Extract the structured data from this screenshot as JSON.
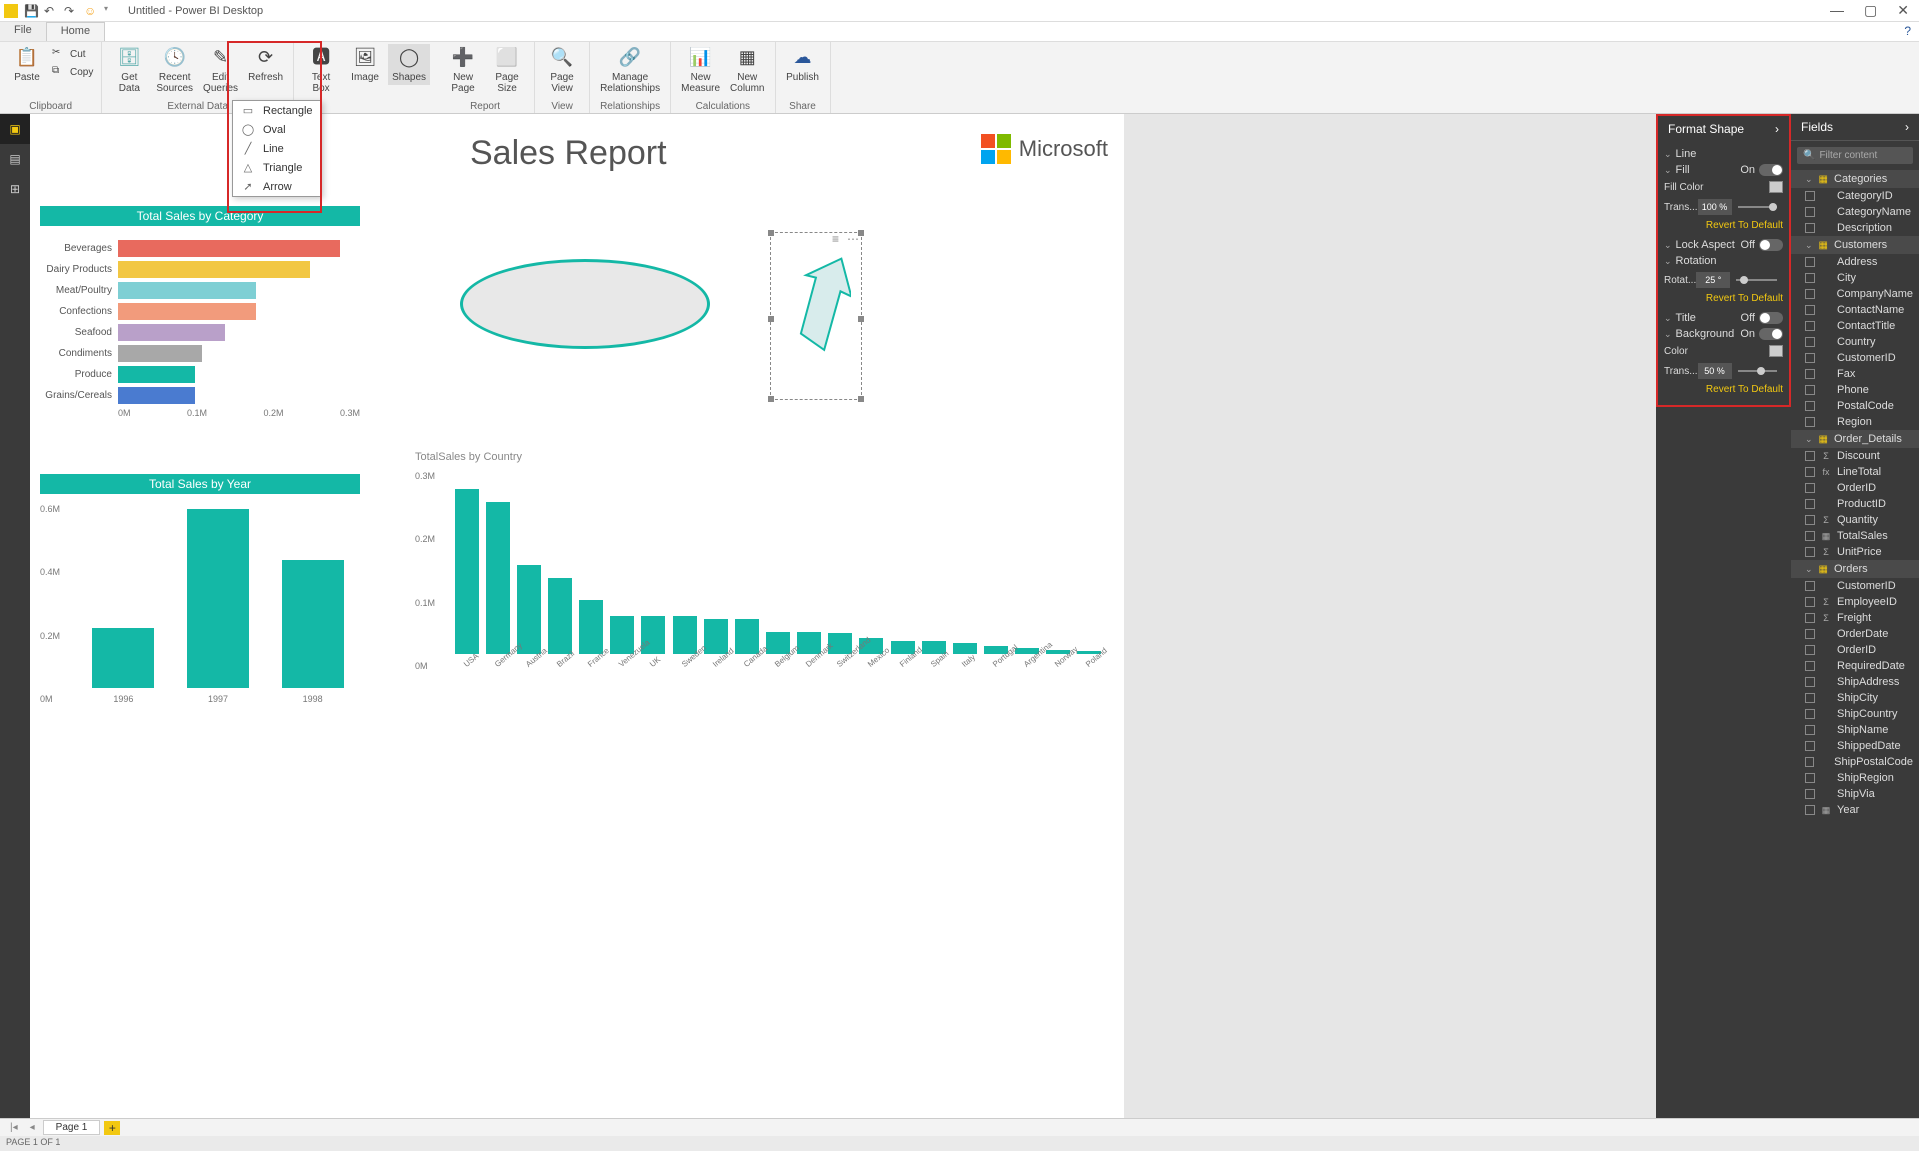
{
  "titlebar": {
    "title": "Untitled - Power BI Desktop"
  },
  "menutabs": {
    "file": "File",
    "home": "Home"
  },
  "ribbon": {
    "clipboard": {
      "label": "Clipboard",
      "paste": "Paste",
      "cut": "Cut",
      "copy": "Copy"
    },
    "external": {
      "label": "External Data",
      "getdata": "Get\nData",
      "recent": "Recent\nSources",
      "edit": "Edit\nQueries",
      "refresh": "Refresh"
    },
    "insert": {
      "textbox": "Text\nBox",
      "image": "Image",
      "shapes": "Shapes"
    },
    "report": {
      "label": "Report",
      "newpage": "New\nPage",
      "pagesize": "Page\nSize"
    },
    "view": {
      "label": "View",
      "pageview": "Page\nView"
    },
    "rel": {
      "label": "Relationships",
      "manage": "Manage\nRelationships"
    },
    "calc": {
      "label": "Calculations",
      "measure": "New\nMeasure",
      "column": "New\nColumn"
    },
    "share": {
      "label": "Share",
      "publish": "Publish"
    }
  },
  "shapesMenu": [
    "Rectangle",
    "Oval",
    "Line",
    "Triangle",
    "Arrow"
  ],
  "report": {
    "title": "Sales Report",
    "brand": "Microsoft",
    "catChart": {
      "title": "Total Sales by Category"
    },
    "yearChart": {
      "title": "Total Sales by Year"
    },
    "countryChart": {
      "title": "TotalSales by Country"
    }
  },
  "format": {
    "head": "Format Shape",
    "line": "Line",
    "fill": "Fill",
    "fillOn": "On",
    "fillColor": "Fill Color",
    "trans": "Trans...",
    "trans1": "100 %",
    "revert": "Revert To Default",
    "lock": "Lock Aspect",
    "lockOff": "Off",
    "rotation": "Rotation",
    "rotat": "Rotat...",
    "rotval": "25 °",
    "titleSec": "Title",
    "titleOff": "Off",
    "bg": "Background",
    "bgOn": "On",
    "color": "Color",
    "trans2": "50 %"
  },
  "fields": {
    "head": "Fields",
    "filter": "Filter content",
    "tables": [
      {
        "name": "Categories",
        "fields": [
          {
            "n": "CategoryID"
          },
          {
            "n": "CategoryName"
          },
          {
            "n": "Description"
          }
        ]
      },
      {
        "name": "Customers",
        "fields": [
          {
            "n": "Address"
          },
          {
            "n": "City"
          },
          {
            "n": "CompanyName"
          },
          {
            "n": "ContactName"
          },
          {
            "n": "ContactTitle"
          },
          {
            "n": "Country"
          },
          {
            "n": "CustomerID"
          },
          {
            "n": "Fax"
          },
          {
            "n": "Phone"
          },
          {
            "n": "PostalCode"
          },
          {
            "n": "Region"
          }
        ]
      },
      {
        "name": "Order_Details",
        "fields": [
          {
            "n": "Discount",
            "i": "Σ"
          },
          {
            "n": "LineTotal",
            "i": "fx"
          },
          {
            "n": "OrderID"
          },
          {
            "n": "ProductID"
          },
          {
            "n": "Quantity",
            "i": "Σ"
          },
          {
            "n": "TotalSales",
            "i": "▦"
          },
          {
            "n": "UnitPrice",
            "i": "Σ"
          }
        ]
      },
      {
        "name": "Orders",
        "fields": [
          {
            "n": "CustomerID"
          },
          {
            "n": "EmployeeID",
            "i": "Σ"
          },
          {
            "n": "Freight",
            "i": "Σ"
          },
          {
            "n": "OrderDate"
          },
          {
            "n": "OrderID"
          },
          {
            "n": "RequiredDate"
          },
          {
            "n": "ShipAddress"
          },
          {
            "n": "ShipCity"
          },
          {
            "n": "ShipCountry"
          },
          {
            "n": "ShipName"
          },
          {
            "n": "ShippedDate"
          },
          {
            "n": "ShipPostalCode"
          },
          {
            "n": "ShipRegion"
          },
          {
            "n": "ShipVia"
          },
          {
            "n": "Year",
            "i": "▦"
          }
        ]
      }
    ]
  },
  "pagetabs": {
    "page1": "Page 1"
  },
  "status": "PAGE 1 OF 1",
  "chart_data": [
    {
      "type": "bar",
      "orientation": "horizontal",
      "title": "Total Sales by Category",
      "categories": [
        "Beverages",
        "Dairy Products",
        "Meat/Poultry",
        "Confections",
        "Seafood",
        "Condiments",
        "Produce",
        "Grains/Cereals"
      ],
      "values": [
        0.29,
        0.25,
        0.18,
        0.18,
        0.14,
        0.11,
        0.1,
        0.1
      ],
      "colors": [
        "#e86a5e",
        "#f2c744",
        "#7ecfd4",
        "#f29b7c",
        "#b9a0c9",
        "#a8a8a8",
        "#14b8a6",
        "#4a7bd0"
      ],
      "xlabel": "",
      "ylabel": "",
      "xlim": [
        0,
        0.3
      ],
      "xticks": [
        "0M",
        "0.1M",
        "0.2M",
        "0.3M"
      ]
    },
    {
      "type": "bar",
      "title": "Total Sales by Year",
      "categories": [
        "1996",
        "1997",
        "1998"
      ],
      "values": [
        0.22,
        0.66,
        0.47
      ],
      "ylim": [
        0,
        0.7
      ],
      "yticks": [
        "0M",
        "0.2M",
        "0.4M",
        "0.6M"
      ],
      "color": "#14b8a6"
    },
    {
      "type": "bar",
      "title": "TotalSales by Country",
      "categories": [
        "USA",
        "Germany",
        "Austria",
        "Brazil",
        "France",
        "Venezuela",
        "UK",
        "Sweden",
        "Ireland",
        "Canada",
        "Belgium",
        "Denmark",
        "Switzerland",
        "Mexico",
        "Finland",
        "Spain",
        "Italy",
        "Portugal",
        "Argentina",
        "Norway",
        "Poland"
      ],
      "values": [
        0.26,
        0.24,
        0.14,
        0.12,
        0.085,
        0.06,
        0.06,
        0.06,
        0.055,
        0.055,
        0.035,
        0.035,
        0.033,
        0.025,
        0.02,
        0.02,
        0.018,
        0.013,
        0.01,
        0.007,
        0.005
      ],
      "ylim": [
        0,
        0.3
      ],
      "yticks": [
        "0M",
        "0.1M",
        "0.2M",
        "0.3M"
      ],
      "color": "#14b8a6"
    }
  ]
}
